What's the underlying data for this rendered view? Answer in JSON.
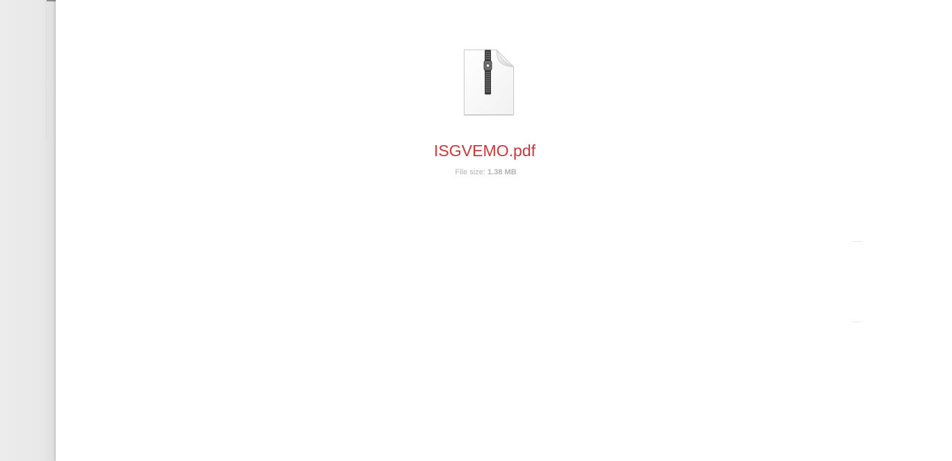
{
  "file": {
    "name": "ISGVEMO.pdf",
    "size_label": "File size:",
    "size_value": "1.38 MB",
    "icon": "zip-file-icon"
  },
  "colors": {
    "file_name": "#c8393a",
    "file_size": "#b3b3b3",
    "sidebar_bg": "#e9e9e9"
  }
}
